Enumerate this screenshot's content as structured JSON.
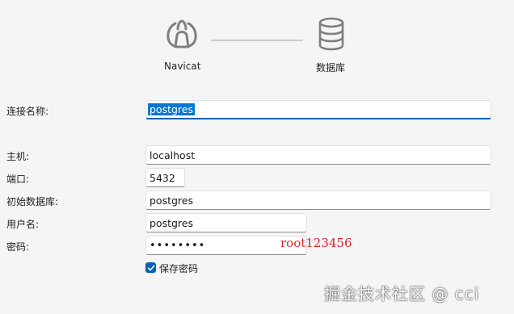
{
  "header": {
    "navicat_label": "Navicat",
    "database_label": "数据库"
  },
  "form": {
    "connection_name_label": "连接名称:",
    "connection_name_value": "postgres",
    "host_label": "主机:",
    "host_value": "localhost",
    "port_label": "端口:",
    "port_value": "5432",
    "initial_db_label": "初始数据库:",
    "initial_db_value": "postgres",
    "username_label": "用户名:",
    "username_value": "postgres",
    "password_label": "密码:",
    "password_mask": "••••••••",
    "password_annotation": "root123456",
    "save_password_label": "保存密码",
    "save_password_checked": true
  },
  "watermark": "掘金技术社区 @ cci",
  "colors": {
    "accent": "#005fb8",
    "selection": "#0078d4",
    "annotation": "#e0262a",
    "background": "#f5f5f5"
  },
  "icons": [
    "navicat-logo-icon",
    "database-icon",
    "checkmark-icon"
  ]
}
